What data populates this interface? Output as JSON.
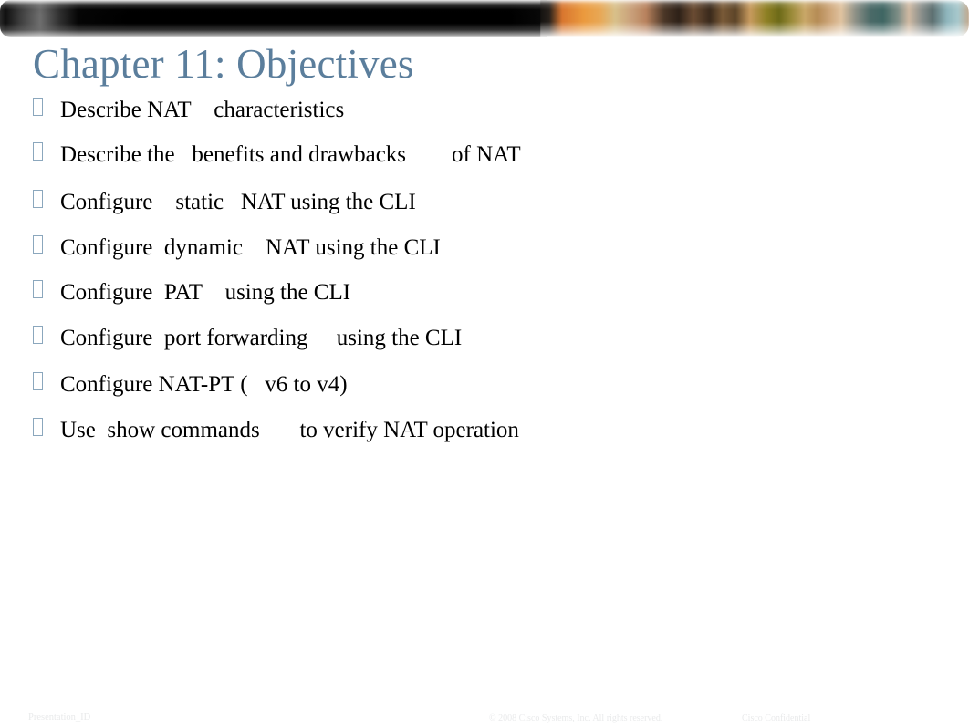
{
  "slide": {
    "title": "Chapter 11: Objectives",
    "title_color": "#5b7e9c",
    "background_color": "#ffffff",
    "body_text_color": "#000000"
  },
  "banner": {
    "bullet_marker_color": "#8ba7bd",
    "dark_bar_color": "#000000",
    "photo_strip_colors": [
      "#d8762f",
      "#eb9a3e",
      "#c9a07a",
      "#4a3627",
      "#7a5a38",
      "#8e8024",
      "#c9a868",
      "#4b6a68",
      "#8fb6bd",
      "#c2a98e"
    ]
  },
  "bullets": [
    {
      "marker": "tofu-box-bullet",
      "text": "Describe NAT    characteristics"
    },
    {
      "marker": "tofu-box-bullet",
      "text": "Describe the   benefits and drawbacks        of NAT"
    },
    {
      "marker": "tofu-box-bullet",
      "text": "Configure    static   NAT using the CLI"
    },
    {
      "marker": "tofu-box-bullet",
      "text": "Configure  dynamic    NAT using the CLI"
    },
    {
      "marker": "tofu-box-bullet",
      "text": "Configure  PAT    using the CLI"
    },
    {
      "marker": "tofu-box-bullet",
      "text": "Configure  port forwarding     using the CLI"
    },
    {
      "marker": "tofu-box-bullet",
      "text": "Configure NAT-PT (   v6 to v4)"
    },
    {
      "marker": "tofu-box-bullet",
      "text": "Use  show commands       to verify NAT operation"
    }
  ],
  "footer": {
    "presentation_id": "Presentation_ID",
    "copyright": "© 2008 Cisco Systems, Inc. All rights reserved.",
    "confidentiality": "Cisco Confidential"
  }
}
